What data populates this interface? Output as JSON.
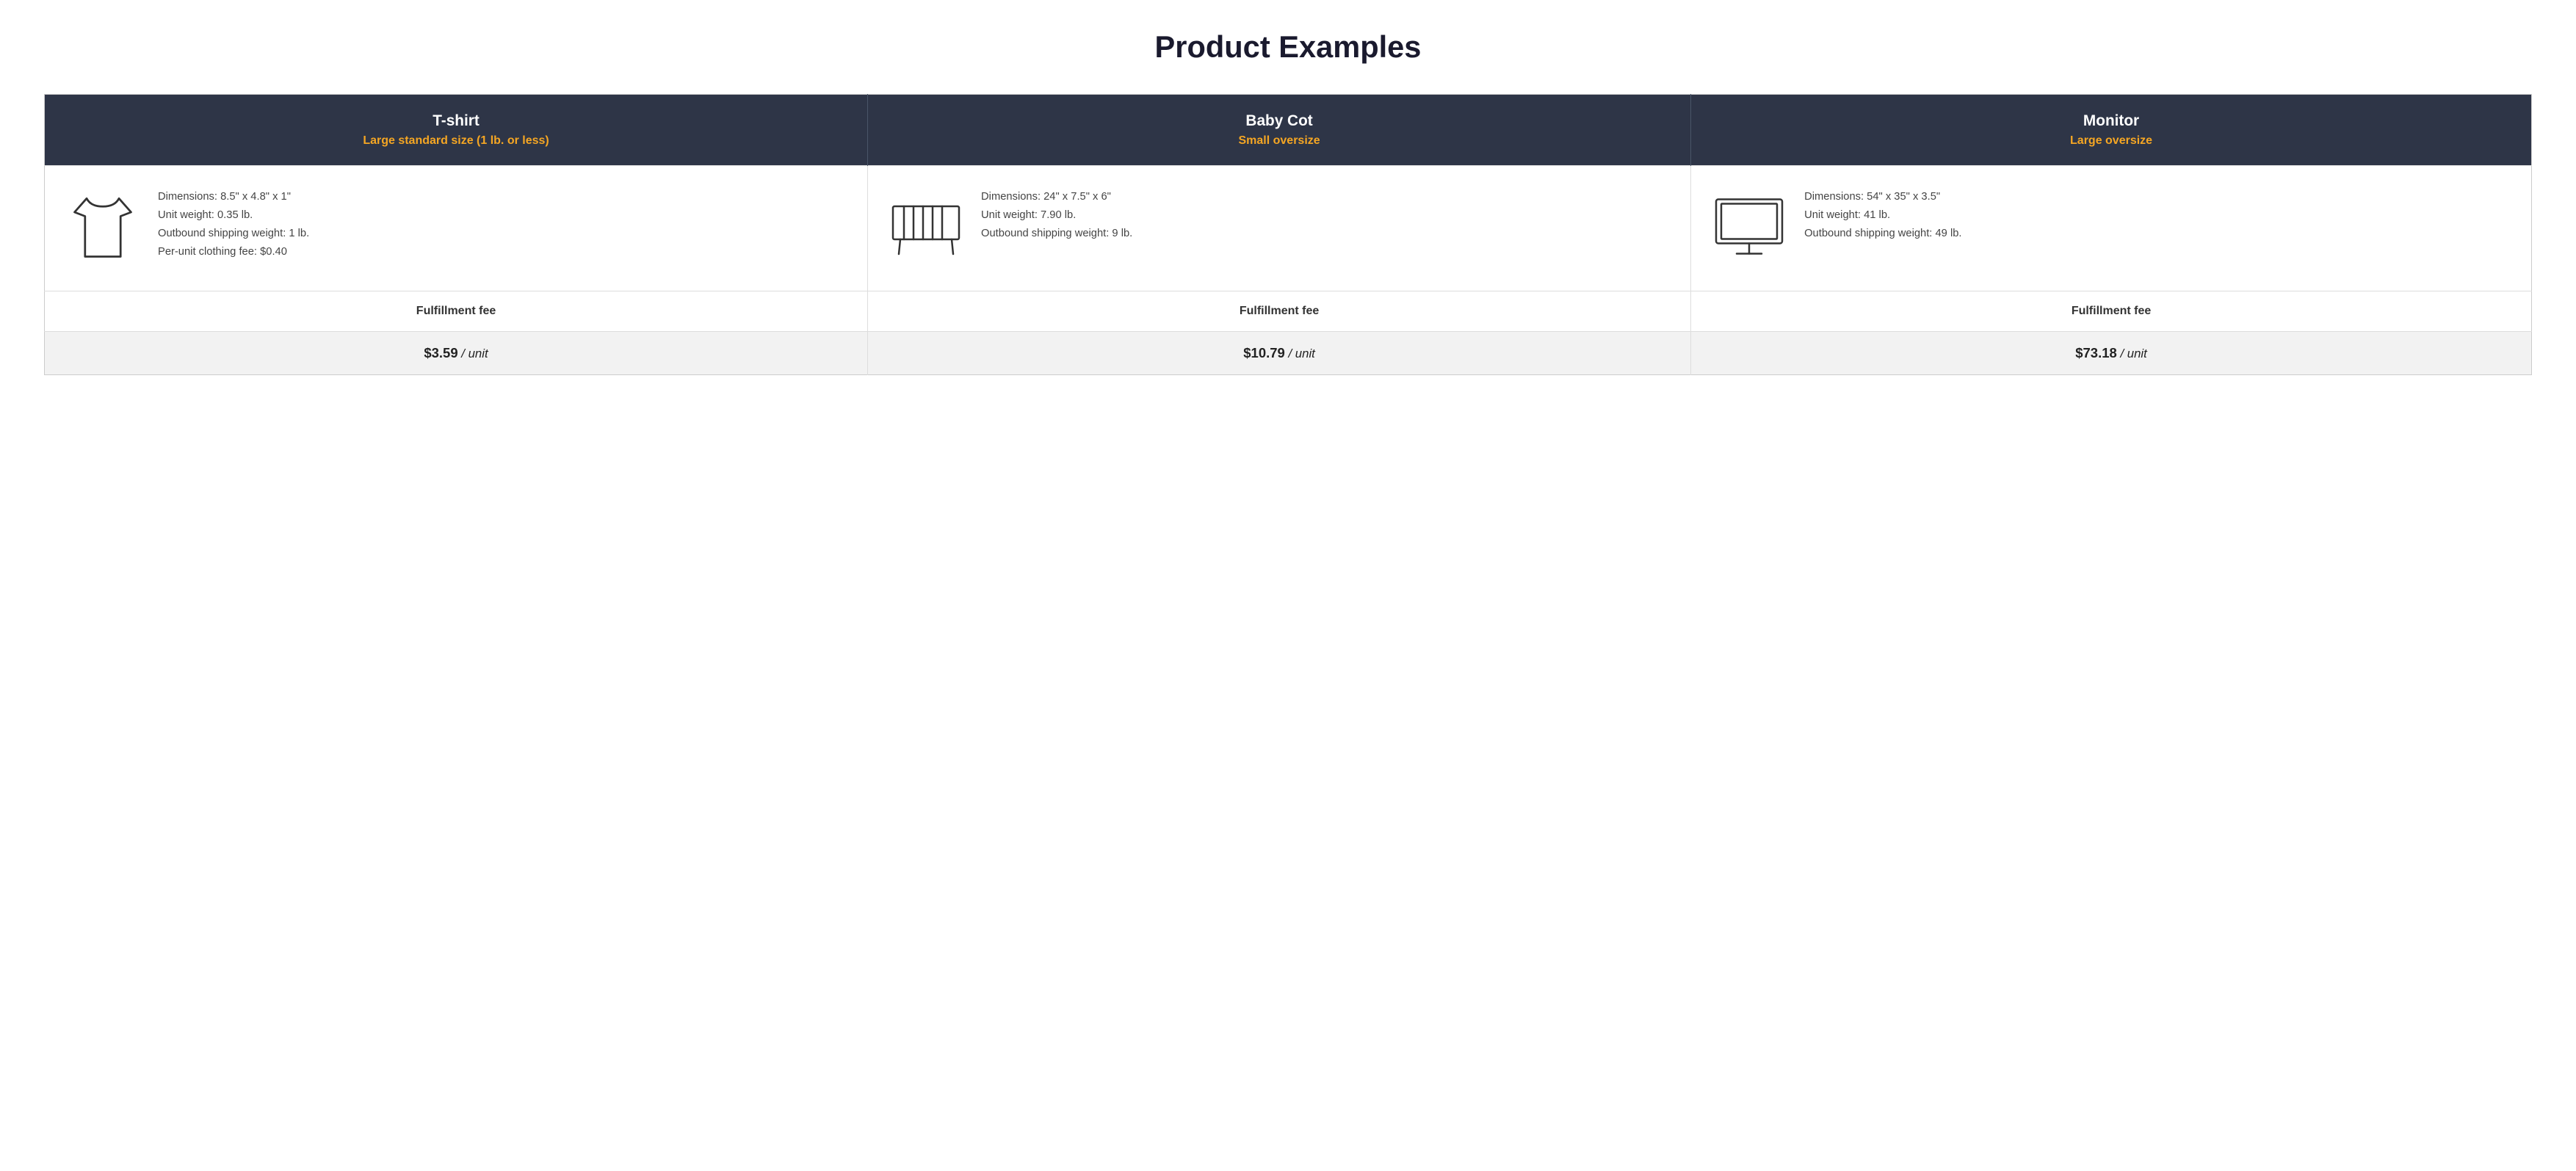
{
  "page": {
    "title": "Product Examples"
  },
  "columns": [
    {
      "name": "T-shirt",
      "category": "Large standard size (1 lb. or less)",
      "dimensions": "Dimensions: 8.5\" x 4.8\" x 1\"",
      "unit_weight": "Unit weight: 0.35 lb.",
      "outbound_weight": "Outbound shipping weight: 1 lb.",
      "extra": "Per-unit clothing fee: $0.40",
      "fulfillment_label": "Fulfillment fee",
      "fee_amount": "$3.59",
      "fee_unit": "/ unit",
      "icon": "tshirt"
    },
    {
      "name": "Baby Cot",
      "category": "Small oversize",
      "dimensions": "Dimensions: 24\" x 7.5\" x 6\"",
      "unit_weight": "Unit weight: 7.90 lb.",
      "outbound_weight": "Outbound shipping weight: 9 lb.",
      "extra": "",
      "fulfillment_label": "Fulfillment fee",
      "fee_amount": "$10.79",
      "fee_unit": "/ unit",
      "icon": "cot"
    },
    {
      "name": "Monitor",
      "category": "Large oversize",
      "dimensions": "Dimensions: 54\" x 35\" x 3.5\"",
      "unit_weight": "Unit weight: 41 lb.",
      "outbound_weight": "Outbound shipping weight: 49 lb.",
      "extra": "",
      "fulfillment_label": "Fulfillment fee",
      "fee_amount": "$73.18",
      "fee_unit": "/ unit",
      "icon": "monitor"
    }
  ]
}
